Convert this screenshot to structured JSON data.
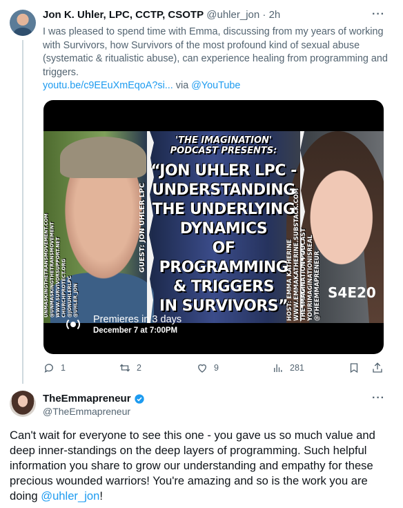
{
  "tweet1": {
    "name": "Jon K. Uhler, LPC, CCTP, CSOTP",
    "handle": "@uhler_jon",
    "time": "2h",
    "more": "···",
    "text": "I was pleased to spend time with Emma, discussing from my years of working with Survivors, how Survivors of the most profound kind of sexual abuse (systematic & ritualistic abuse), can experience healing from programming and triggers.",
    "link": "youtu.be/c9EEuXmEqoA?si...",
    "via": "via",
    "via_link": "@YouTube",
    "media": {
      "kicker": "'THE IMAGINATION' PODCAST PRESENTS:",
      "headline_lines": [
        "“JON UHLER LPC -",
        "UNDERSTANDING",
        "THE UNDERLYING",
        "DYNAMICS",
        "OF",
        "PROGRAMMING",
        "& TRIGGERS",
        "IN SURVIVORS”"
      ],
      "guest": "GUEST: JON UHLER LPC",
      "host_lines": [
        "HOST: EMMA KATHERINE",
        "WWW.EMMAKATHERINE.SUBSTACK.COM",
        "THE IMAGINATION PODCAST",
        "YOURIMAGINATIONISREAL",
        "@THEEMMAPRENEUR"
      ],
      "left_lines": [
        "UNMASKINGTHETRANSMOVEMENT.COM",
        "@UNMASKINGTHETRANSMOVEMENT",
        "WWW.SURVIVORSUPPORT.NET",
        "CHURCHPROTECT.ORG",
        "@JONUHLERLPC",
        "@UHLER_JON"
      ],
      "episode": "S4E20",
      "premiere_title": "Premieres in 3 days",
      "premiere_date": "December 7 at 7:00PM"
    },
    "actions": {
      "replies": "1",
      "reposts": "2",
      "likes": "9",
      "views": "281"
    }
  },
  "tweet2": {
    "name": "TheEmmapreneur",
    "handle": "@TheEmmapreneur",
    "more": "···",
    "text": "Can't wait for everyone to see this one - you gave us so much value and deep inner-standings on the deep layers of programming. Such helpful information you share to grow our understanding and empathy for these precious wounded warriors! You're amazing and so is the work you are doing ",
    "mention": "@uhler_jon",
    "end": "!"
  },
  "colors": {
    "link": "#1d9bf0",
    "muted": "#536471",
    "text": "#0f1419",
    "badge_x": "#e0302f"
  },
  "icons": [
    "reply-icon",
    "repost-icon",
    "like-icon",
    "views-icon",
    "bookmark-icon",
    "share-icon",
    "verified-icon",
    "live-icon",
    "more-icon"
  ]
}
